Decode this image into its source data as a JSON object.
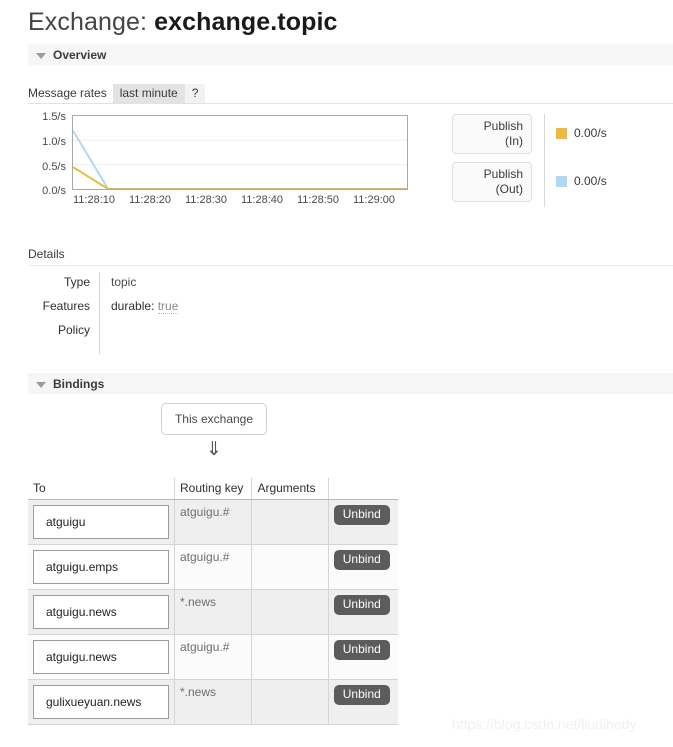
{
  "page": {
    "title_prefix": "Exchange: ",
    "title_name": "exchange.topic",
    "watermark": "https://blog.csdn.net/liudihedy"
  },
  "overview": {
    "section_label": "Overview",
    "rates_label": "Message rates",
    "rates_period": "last minute",
    "help": "?"
  },
  "chart_data": {
    "type": "line",
    "title": "Message rates",
    "xlabel": "",
    "ylabel": "",
    "ylim": [
      0,
      1.5
    ],
    "grid": true,
    "legend_position": "right",
    "y_ticks": [
      "1.5/s",
      "1.0/s",
      "0.5/s",
      "0.0/s"
    ],
    "y_tick_values": [
      1.5,
      1.0,
      0.5,
      0.0
    ],
    "x_ticks": [
      "11:28:10",
      "11:28:20",
      "11:28:30",
      "11:28:40",
      "11:28:50",
      "11:29:00"
    ],
    "series": [
      {
        "name": "Publish (In)",
        "color": "#edba3c",
        "current_rate": "0.00/s",
        "x": [
          "11:28:05",
          "11:28:13",
          "11:29:05"
        ],
        "values": [
          0.45,
          0.0,
          0.0
        ]
      },
      {
        "name": "Publish (Out)",
        "color": "#aed9f2",
        "current_rate": "0.00/s",
        "x": [
          "11:28:05",
          "11:28:13",
          "11:29:05"
        ],
        "values": [
          1.2,
          0.0,
          0.0
        ]
      }
    ]
  },
  "legend": {
    "buttons": [
      {
        "line1": "Publish",
        "line2": "(In)"
      },
      {
        "line1": "Publish",
        "line2": "(Out)"
      }
    ],
    "values": [
      {
        "color": "#edba3c",
        "rate": "0.00/s"
      },
      {
        "color": "#aed9f2",
        "rate": "0.00/s"
      }
    ]
  },
  "details": {
    "heading": "Details",
    "rows": [
      {
        "label": "Type",
        "value": "topic"
      },
      {
        "label": "Features",
        "feature_key": "durable:",
        "feature_value": "true"
      },
      {
        "label": "Policy",
        "value": ""
      }
    ]
  },
  "bindings": {
    "section_label": "Bindings",
    "source_box": "This exchange",
    "arrow": "⇓",
    "columns": [
      "To",
      "Routing key",
      "Arguments",
      ""
    ],
    "rows": [
      {
        "to": "atguigu",
        "routing_key": "atguigu.#",
        "arguments": "",
        "action": "Unbind"
      },
      {
        "to": "atguigu.emps",
        "routing_key": "atguigu.#",
        "arguments": "",
        "action": "Unbind"
      },
      {
        "to": "atguigu.news",
        "routing_key": "*.news",
        "arguments": "",
        "action": "Unbind"
      },
      {
        "to": "atguigu.news",
        "routing_key": "atguigu.#",
        "arguments": "",
        "action": "Unbind"
      },
      {
        "to": "gulixueyuan.news",
        "routing_key": "*.news",
        "arguments": "",
        "action": "Unbind"
      }
    ]
  }
}
